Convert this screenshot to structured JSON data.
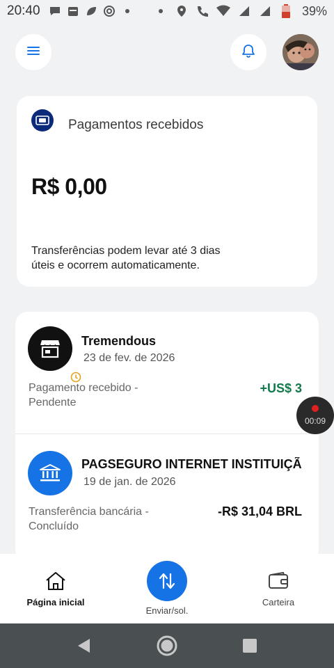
{
  "status_bar": {
    "time": "20:40",
    "battery_percent": "39%",
    "network": "4G"
  },
  "header": {
    "menu_icon": "hamburger-menu-icon",
    "bell_icon": "bell-icon",
    "avatar": "user-avatar"
  },
  "payments_card": {
    "title": "Pagamentos recebidos",
    "amount": "R$ 0,00",
    "note": "Transferências podem levar até 3 dias úteis e ocorrem automaticamente."
  },
  "transactions": [
    {
      "name": "Tremendous",
      "date": "23 de fev. de 2026",
      "description": "Pagamento recebido - Pendente",
      "amount": "+US$ 3",
      "icon": "store-icon",
      "badge_icon": "clock-icon"
    },
    {
      "name": "PAGSEGURO INTERNET INSTITUIÇÃ",
      "date": "19 de jan. de 2026",
      "description": "Transferência bancária - Concluído",
      "amount": "-R$ 31,04 BRL",
      "icon": "bank-icon"
    }
  ],
  "recording": {
    "timer": "00:09"
  },
  "bottom_nav": {
    "home_label": "Página inicial",
    "send_label": "Enviar/sol.",
    "wallet_label": "Carteira"
  },
  "colors": {
    "accent": "#1673e6",
    "dark_navy": "#0b2a7a",
    "positive": "#117a4b",
    "background": "#f1f2f4"
  }
}
